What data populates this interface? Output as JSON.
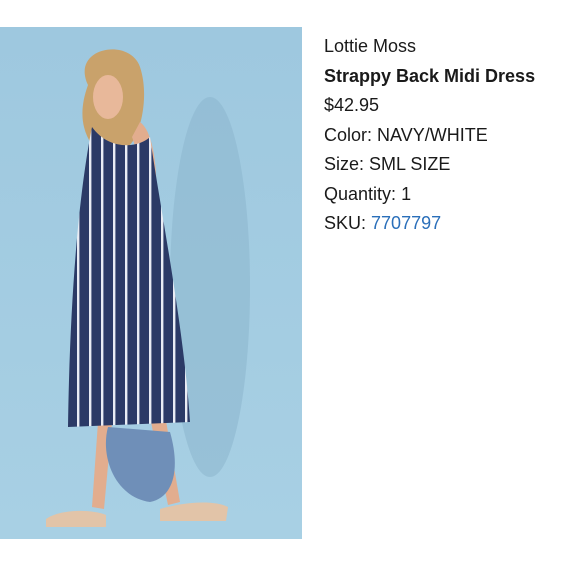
{
  "product": {
    "brand": "Lottie Moss",
    "name": "Strappy Back Midi Dress",
    "price": "$42.95",
    "color_label": "Color:",
    "color_value": "NAVY/WHITE",
    "size_label": "Size:",
    "size_value": "SML SIZE",
    "quantity_label": "Quantity:",
    "quantity_value": "1",
    "sku_label": "SKU:",
    "sku_value": "7707797"
  },
  "colors": {
    "background_backdrop": "#9ec8df",
    "dress_navy": "#2b3a66",
    "sku_link": "#2a6fba"
  }
}
